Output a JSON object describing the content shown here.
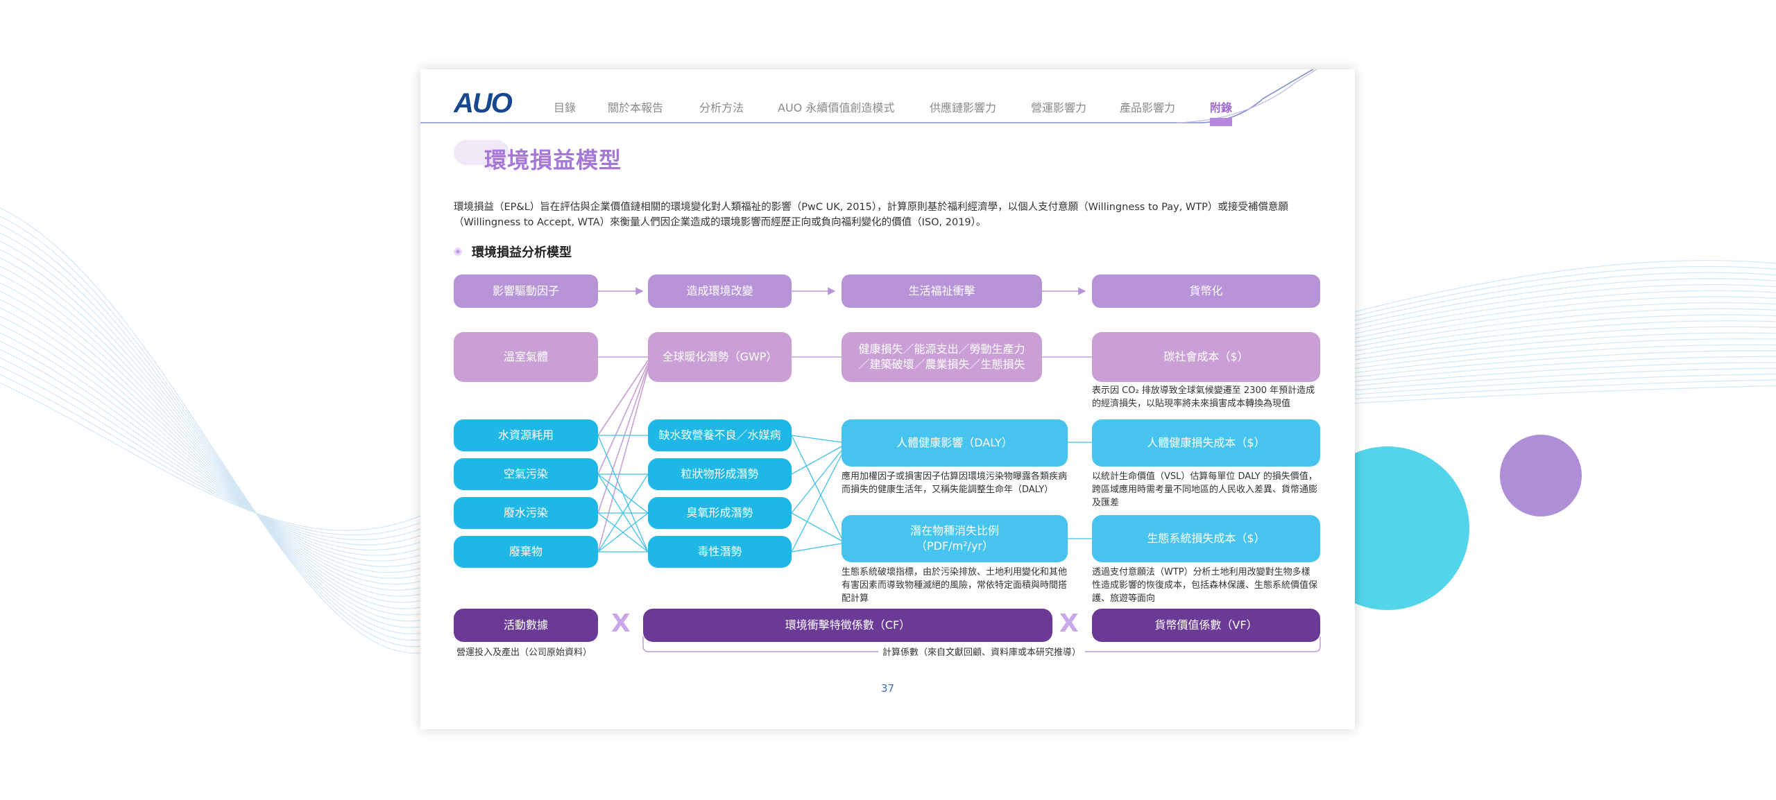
{
  "nav": {
    "logo": "AUO",
    "items": [
      "目錄",
      "關於本報告",
      "分析方法",
      "AUO 永續價值創造模式",
      "供應鏈影響力",
      "營運影響力",
      "產品影響力",
      "附錄"
    ],
    "active_index": 7
  },
  "page": {
    "title": "環境損益模型",
    "intro_line1": "環境損益（EP&L）旨在評估與企業價值鏈相關的環境變化對人類福祉的影響（PwC UK, 2015），計算原則基於福利經濟學，以個人支付意願（Willingness to Pay, WTP）或接受補償意願",
    "intro_line2": "（Willingness to Accept, WTA）來衡量人們因企業造成的環境影響而經歷正向或負向福利變化的價值（ISO, 2019）。",
    "subheading": "環境損益分析模型",
    "page_number": "37"
  },
  "diagram": {
    "headers": [
      "影響驅動因子",
      "造成環境改變",
      "生活福祉衝擊",
      "貨幣化"
    ],
    "ghg_row": {
      "driver": "溫室氣體",
      "change": "全球暖化潛勢（GWP）",
      "impact": "健康損失／能源支出／勞動生產力／建築破壞／農業損失／生態損失",
      "impact_line1": "健康損失／能源支出／勞動生產力",
      "impact_line2": "／建築破壞／農業損失／生態損失",
      "value": "碳社會成本（$）",
      "value_note_line1": "表示因 CO₂ 排放導致全球氣候變遷至 2300 年預計造成",
      "value_note_line2": "的經濟損失，以貼現率將未來損害成本轉換為現值"
    },
    "drivers": [
      "水資源耗用",
      "空氣污染",
      "廢水污染",
      "廢棄物"
    ],
    "changes": [
      "缺水致營養不良／水媒病",
      "粒狀物形成潛勢",
      "臭氧形成潛勢",
      "毒性潛勢"
    ],
    "impacts": [
      {
        "label": "人體健康影響（DALY）",
        "note_line1": "應用加權因子或損害因子估算因環境污染物曝露各類疾病",
        "note_line2": "而損失的健康生活年，又稱失能調整生命年（DALY）"
      },
      {
        "label_line1": "潛在物種消失比例",
        "label_line2": "（PDF/m²/yr）",
        "note_line1": "生態系統破壞指標，由於污染排放、土地利用變化和其他",
        "note_line2": "有害因素而導致物種滅絕的風險，常依特定面積與時間搭",
        "note_line3": "配計算"
      }
    ],
    "values": [
      {
        "label": "人體健康損失成本（$）",
        "note_line1": "以統計生命價值（VSL）估算每單位 DALY 的損失價值，",
        "note_line2": "跨區域應用時需考量不同地區的人民收入差異、貨幣通膨",
        "note_line3": "及匯差"
      },
      {
        "label": "生態系統損失成本（$）",
        "note_line1": "透過支付意願法（WTP）分析土地利用改變對生物多樣",
        "note_line2": "性造成影響的恢復成本，包括森林保護、生態系統價值保",
        "note_line3": "護、旅遊等面向"
      }
    ],
    "formula": {
      "activity": "活動數據",
      "activity_note": "營運投入及產出（公司原始資料）",
      "multiply_1": "X",
      "cf": "環境衝擊特徵係數（CF）",
      "multiply_2": "X",
      "vf": "貨幣價值係數（VF）",
      "coefficients_note": "計算係數（來自文獻回顧、資料庫或本研究推導）"
    }
  },
  "colors": {
    "header_purple": "#b794d8",
    "light_purple": "#c99fd6",
    "cyan": "#1fb8e6",
    "light_cyan": "#46c4ef",
    "dark_purple": "#6a3a96",
    "title_purple": "#a577d6"
  }
}
